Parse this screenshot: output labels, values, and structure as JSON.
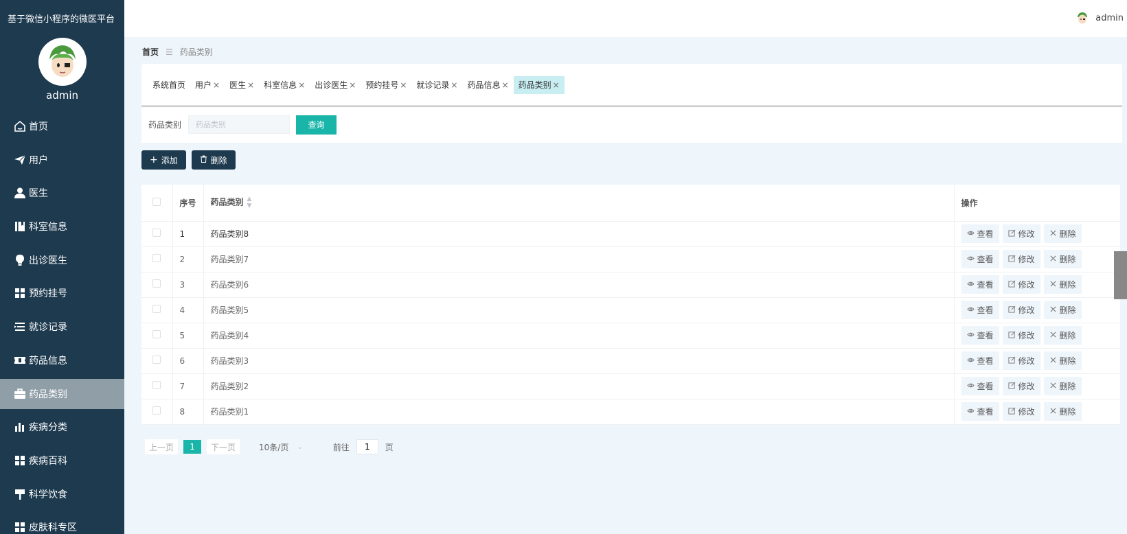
{
  "app": {
    "title": "基于微信小程序的微医平台"
  },
  "profile": {
    "name": "admin"
  },
  "topbar": {
    "username": "admin"
  },
  "sidebar": {
    "items": [
      {
        "label": "首页",
        "icon": "home-icon"
      },
      {
        "label": "用户",
        "icon": "paper-plane-icon"
      },
      {
        "label": "医生",
        "icon": "person-icon"
      },
      {
        "label": "科室信息",
        "icon": "book-icon"
      },
      {
        "label": "出诊医生",
        "icon": "lightbulb-icon"
      },
      {
        "label": "预约挂号",
        "icon": "grid-icon"
      },
      {
        "label": "就诊记录",
        "icon": "list-icon"
      },
      {
        "label": "药品信息",
        "icon": "ticket-icon"
      },
      {
        "label": "药品类别",
        "icon": "briefcase-icon",
        "active": true
      },
      {
        "label": "疾病分类",
        "icon": "bar-chart-icon"
      },
      {
        "label": "疾病百科",
        "icon": "grid-icon"
      },
      {
        "label": "科学饮食",
        "icon": "signpost-icon"
      },
      {
        "label": "皮肤科专区",
        "icon": "grid-icon"
      }
    ]
  },
  "breadcrumb": {
    "home": "首页",
    "separator": "☰",
    "current": "药品类别"
  },
  "tabs": [
    {
      "label": "系统首页",
      "closable": false
    },
    {
      "label": "用户",
      "closable": true
    },
    {
      "label": "医生",
      "closable": true
    },
    {
      "label": "科室信息",
      "closable": true
    },
    {
      "label": "出诊医生",
      "closable": true
    },
    {
      "label": "预约挂号",
      "closable": true
    },
    {
      "label": "就诊记录",
      "closable": true
    },
    {
      "label": "药品信息",
      "closable": true
    },
    {
      "label": "药品类别",
      "closable": true,
      "active": true
    }
  ],
  "search": {
    "label": "药品类别",
    "placeholder": "药品类别",
    "button": "查询"
  },
  "actions": {
    "add": "添加",
    "delete": "删除"
  },
  "table": {
    "headers": {
      "index": "序号",
      "name": "药品类别",
      "ops": "操作"
    },
    "ops": {
      "view": "查看",
      "edit": "修改",
      "delete": "删除"
    },
    "rows": [
      {
        "index": "1",
        "name": "药品类别8"
      },
      {
        "index": "2",
        "name": "药品类别7"
      },
      {
        "index": "3",
        "name": "药品类别6"
      },
      {
        "index": "4",
        "name": "药品类别5"
      },
      {
        "index": "5",
        "name": "药品类别4"
      },
      {
        "index": "6",
        "name": "药品类别3"
      },
      {
        "index": "7",
        "name": "药品类别2"
      },
      {
        "index": "8",
        "name": "药品类别1"
      }
    ]
  },
  "pagination": {
    "prev": "上一页",
    "current": "1",
    "next": "下一页",
    "page_size": "10条/页",
    "goto_label": "前往",
    "goto_value": "1",
    "page_suffix": "页"
  },
  "colors": {
    "sidebar": "#1e3a4f",
    "accent": "#1ab5a9",
    "active_tab": "#c8eef2"
  }
}
